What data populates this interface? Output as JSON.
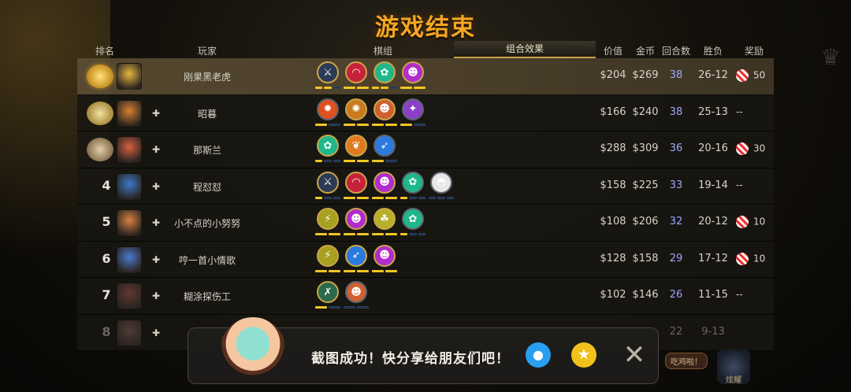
{
  "title": "游戏结束",
  "headers": {
    "rank": "排名",
    "player": "玩家",
    "lineup": "棋组",
    "synergy_tab": "组合效果",
    "value": "价值",
    "gold": "金币",
    "rounds": "回合数",
    "win_loss": "胜负",
    "reward": "奖励"
  },
  "players": [
    {
      "rank": "",
      "name": "刚果黑老虎",
      "value": "$204",
      "gold": "$269",
      "rounds": "38",
      "wl": "26-12",
      "reward": "50"
    },
    {
      "rank": "",
      "name": "昭暮",
      "value": "$166",
      "gold": "$240",
      "rounds": "38",
      "wl": "25-13",
      "reward": "--"
    },
    {
      "rank": "",
      "name": "那斯兰",
      "value": "$288",
      "gold": "$309",
      "rounds": "36",
      "wl": "20-16",
      "reward": "30"
    },
    {
      "rank": "4",
      "name": "程怼怼",
      "value": "$158",
      "gold": "$225",
      "rounds": "33",
      "wl": "19-14",
      "reward": "--"
    },
    {
      "rank": "5",
      "name": "小不点的小努努",
      "value": "$108",
      "gold": "$206",
      "rounds": "32",
      "wl": "20-12",
      "reward": "10"
    },
    {
      "rank": "6",
      "name": "哼一首小情歌",
      "value": "$128",
      "gold": "$158",
      "rounds": "29",
      "wl": "17-12",
      "reward": "10"
    },
    {
      "rank": "7",
      "name": "糊涂探伤工",
      "value": "$102",
      "gold": "$146",
      "rounds": "26",
      "wl": "11-15",
      "reward": "--"
    },
    {
      "rank": "8",
      "name": "",
      "value": "",
      "gold": "",
      "rounds": "22",
      "wl": "9-13",
      "reward": ""
    }
  ],
  "traits": [
    [
      {
        "icon": "axe",
        "color": "#2b3b55",
        "border": "#c9a54a",
        "glyph": "⚔",
        "bars": [
          1,
          1,
          0
        ]
      },
      {
        "icon": "arch",
        "color": "#c8223a",
        "border": "#c9a54a",
        "glyph": "◠",
        "bars": [
          1,
          1
        ]
      },
      {
        "icon": "paw",
        "color": "#1fb88a",
        "border": "#c9a54a",
        "glyph": "✿",
        "bars": [
          1,
          1,
          0
        ]
      },
      {
        "icon": "skull",
        "color": "#b12ccc",
        "border": "#c9a54a",
        "glyph": "☻",
        "bars": [
          1,
          1
        ]
      }
    ],
    [
      {
        "icon": "fire",
        "color": "#e0501e",
        "border": "#5c6470",
        "glyph": "✹",
        "bars": [
          1,
          0
        ]
      },
      {
        "icon": "gear",
        "color": "#c87a1e",
        "border": "#c9a54a",
        "glyph": "✺",
        "bars": [
          1,
          1
        ]
      },
      {
        "icon": "goblin",
        "color": "#d06030",
        "border": "#c9a54a",
        "glyph": "☻",
        "bars": [
          1,
          1
        ]
      },
      {
        "icon": "fish",
        "color": "#8a40c8",
        "border": "#5c6470",
        "glyph": "✦",
        "bars": [
          1,
          0
        ]
      }
    ],
    [
      {
        "icon": "paw",
        "color": "#1fb88a",
        "border": "#c9a54a",
        "glyph": "✿",
        "bars": [
          1,
          0,
          0
        ]
      },
      {
        "icon": "leaf",
        "color": "#e07a20",
        "border": "#c9a54a",
        "glyph": "❦",
        "bars": [
          1,
          1
        ]
      },
      {
        "icon": "dart",
        "color": "#2a7ae0",
        "border": "#5c6470",
        "glyph": "➶",
        "bars": [
          1,
          0
        ]
      }
    ],
    [
      {
        "icon": "axe",
        "color": "#2b3b55",
        "border": "#c9a54a",
        "glyph": "⚔",
        "bars": [
          1,
          0,
          0
        ]
      },
      {
        "icon": "arch",
        "color": "#c8223a",
        "border": "#c9a54a",
        "glyph": "◠",
        "bars": [
          1,
          1
        ]
      },
      {
        "icon": "skull",
        "color": "#b12ccc",
        "border": "#c9a54a",
        "glyph": "☻",
        "bars": [
          1,
          1
        ]
      },
      {
        "icon": "paw",
        "color": "#1fb88a",
        "border": "#5c6470",
        "glyph": "✿",
        "bars": [
          1,
          0,
          0
        ]
      },
      {
        "icon": "ghost",
        "color": "#e8e8e8",
        "border": "#5c6470",
        "glyph": "◓",
        "bars": [
          0,
          0,
          0
        ]
      }
    ],
    [
      {
        "icon": "claw",
        "color": "#a8a020",
        "border": "#c9a54a",
        "glyph": "⚡",
        "bars": [
          1,
          1
        ]
      },
      {
        "icon": "skull",
        "color": "#b12ccc",
        "border": "#c9a54a",
        "glyph": "☻",
        "bars": [
          1,
          1
        ]
      },
      {
        "icon": "trio",
        "color": "#b6b02a",
        "border": "#c9a54a",
        "glyph": "☘",
        "bars": [
          1,
          1
        ]
      },
      {
        "icon": "paw",
        "color": "#1fb88a",
        "border": "#5c6470",
        "glyph": "✿",
        "bars": [
          1,
          0,
          0
        ]
      }
    ],
    [
      {
        "icon": "claw",
        "color": "#a8a020",
        "border": "#c9a54a",
        "glyph": "⚡",
        "bars": [
          1,
          1
        ]
      },
      {
        "icon": "dart",
        "color": "#2a7ae0",
        "border": "#c9a54a",
        "glyph": "➶",
        "bars": [
          1,
          1
        ]
      },
      {
        "icon": "skull",
        "color": "#b12ccc",
        "border": "#c9a54a",
        "glyph": "☻",
        "bars": [
          1,
          1
        ]
      }
    ],
    [
      {
        "icon": "bow",
        "color": "#2b6a4a",
        "border": "#c9a54a",
        "glyph": "✗",
        "bars": [
          1,
          0
        ]
      },
      {
        "icon": "goblin",
        "color": "#d06030",
        "border": "#5c6470",
        "glyph": "☻",
        "bars": [
          0,
          0
        ]
      }
    ],
    []
  ],
  "toast": {
    "message": "截图成功！快分享给朋友们吧！"
  },
  "chip_label": "吃鸡啦！",
  "chip_icon_label": "炫耀",
  "colors": {
    "accent": "#f5a623",
    "rounds": "#9fa6ff",
    "bar_on": "#f3c623"
  }
}
